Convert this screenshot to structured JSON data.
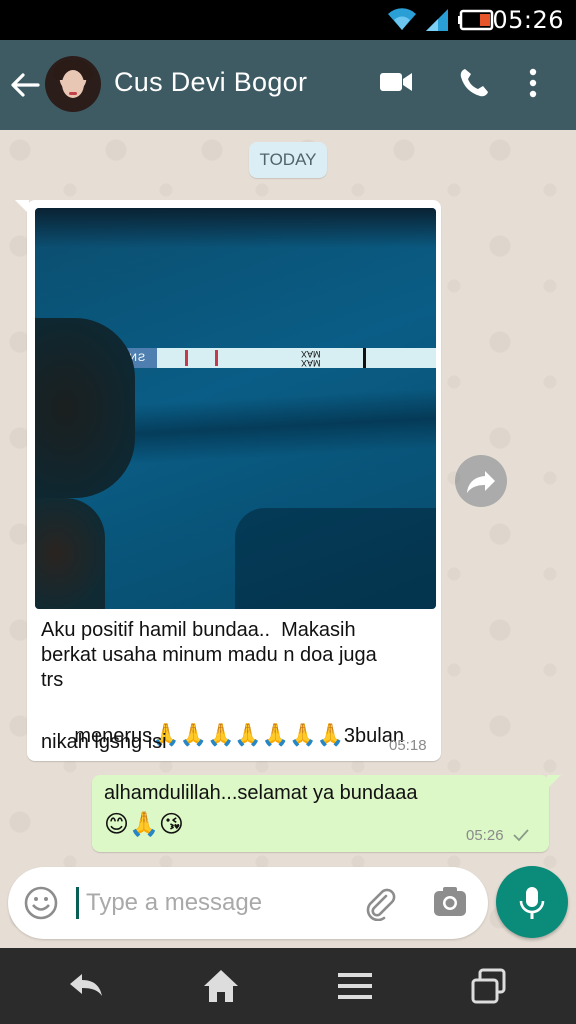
{
  "status_bar": {
    "time": "05:26"
  },
  "header": {
    "contact_name": "Cus Devi Bogor"
  },
  "chat": {
    "date_chip": "TODAY",
    "incoming": {
      "line1": "Aku positif hamil bundaa..  Makasih",
      "line2": "berkat usaha minum madu n doa juga",
      "line3": "trs",
      "line4_prefix": "menerus",
      "line4_emojis": "🙏🙏🙏🙏🙏🙏🙏",
      "line4_suffix": "3bulan",
      "line5": "nikah lgsng isi",
      "time": "05:18",
      "photo_strip_label": "SNSIHƐ SNSIHƐ",
      "photo_strip_text": "MAX\nMAX"
    },
    "outgoing": {
      "text": "alhamdulillah...selamat ya bundaaa",
      "emojis": "😊🙏😘",
      "time": "05:26"
    }
  },
  "composer": {
    "placeholder": "Type a message"
  },
  "colors": {
    "app_bar": "#3e5b64",
    "outgoing_bubble": "#dcf8c6",
    "mic_button": "#0b8b79",
    "nav_bar": "#2b2b2b"
  },
  "icons": [
    "wifi-icon",
    "signal-icon",
    "battery-icon",
    "back-arrow-icon",
    "video-call-icon",
    "phone-icon",
    "more-vert-icon",
    "forward-icon",
    "emoji-icon",
    "attach-icon",
    "camera-icon",
    "mic-icon",
    "nav-back-icon",
    "nav-home-icon",
    "nav-menu-icon",
    "nav-recents-icon"
  ]
}
